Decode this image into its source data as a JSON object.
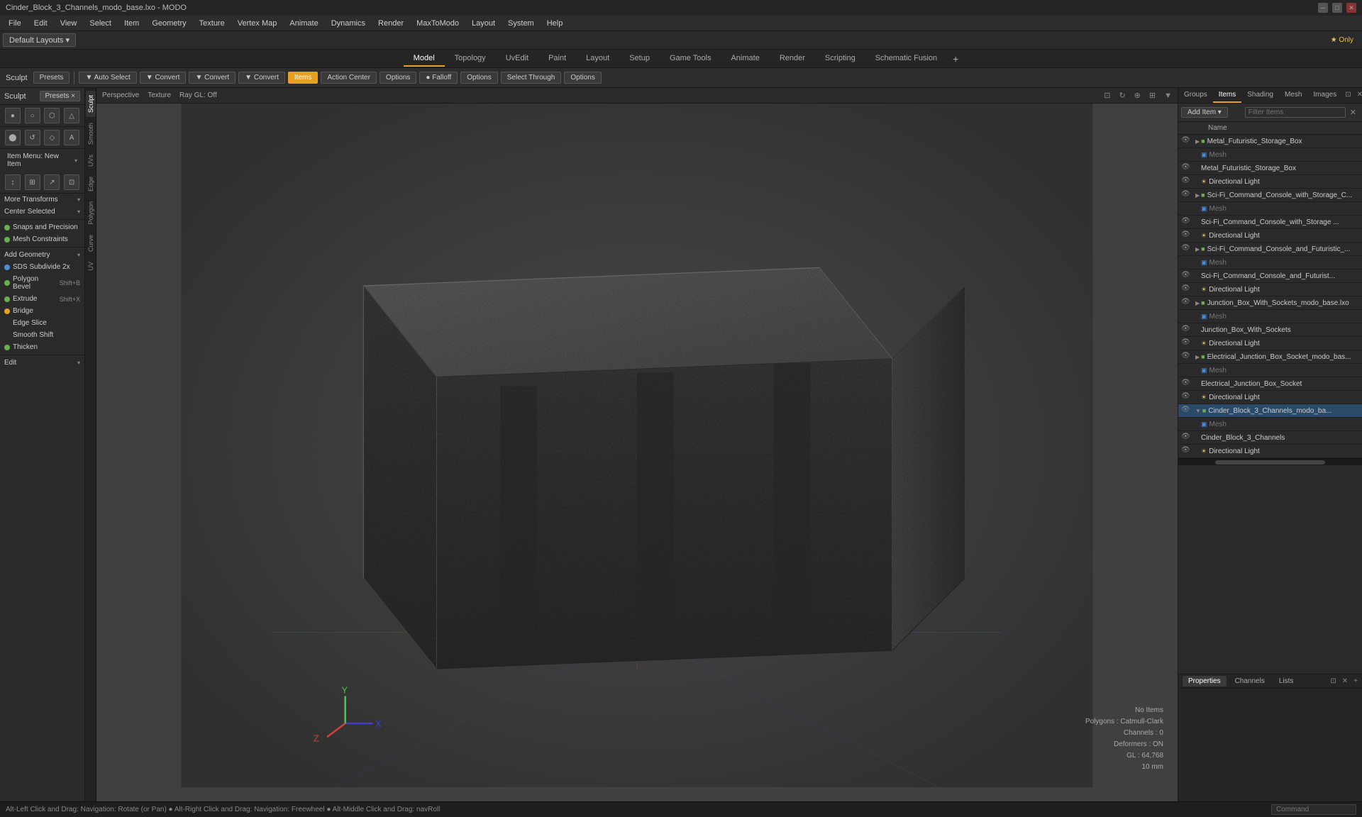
{
  "window": {
    "title": "Cinder_Block_3_Channels_modo_base.lxo - MODO"
  },
  "titlebar": {
    "title": "Cinder_Block_3_Channels_modo_base.lxo - MODO",
    "min": "─",
    "max": "□",
    "close": "✕"
  },
  "menubar": {
    "items": [
      "File",
      "Edit",
      "View",
      "Select",
      "Item",
      "Geometry",
      "Texture",
      "Vertex Map",
      "Animate",
      "Dynamics",
      "Render",
      "MaxToModo",
      "Layout",
      "System",
      "Help"
    ]
  },
  "layoutbar": {
    "layout": "Default Layouts",
    "only_label": "★ Only"
  },
  "modetabs": {
    "tabs": [
      "Model",
      "Topology",
      "UvEdit",
      "Paint",
      "Layout",
      "Setup",
      "Game Tools",
      "Animate",
      "Render",
      "Scripting",
      "Schematic Fusion"
    ],
    "active": "Model"
  },
  "toolbar": {
    "sculpt_label": "Sculpt",
    "presets_label": "Presets",
    "buttons": [
      {
        "label": "Auto Select",
        "active": false,
        "icon": "▼"
      },
      {
        "label": "Convert",
        "active": false
      },
      {
        "label": "Convert",
        "active": false
      },
      {
        "label": "Convert",
        "active": false
      },
      {
        "label": "Items",
        "active": true
      },
      {
        "label": "Action Center",
        "active": false
      },
      {
        "label": "Options",
        "active": false
      },
      {
        "label": "Falloff",
        "active": false
      },
      {
        "label": "Options",
        "active": false
      },
      {
        "label": "Select Through",
        "active": false
      },
      {
        "label": "Options",
        "active": false
      }
    ]
  },
  "leftpanel": {
    "sculpt": "Sculpt",
    "presets": "Presets",
    "tool_rows": [
      [
        "●",
        "○",
        "⬡",
        "△"
      ],
      [
        "⬤",
        "↺",
        "◇",
        "A"
      ]
    ],
    "item_menu_label": "Item Menu: New Item",
    "transform_icons": [
      "↕",
      "⊞",
      "↗",
      "⊡"
    ],
    "more_transforms": "More Transforms",
    "center_selected": "Center Selected",
    "snaps_precision": "Snaps and Precision",
    "mesh_constraints": "Mesh Constraints",
    "add_geometry": "Add Geometry",
    "tools": [
      {
        "name": "SDS Subdivide 2x",
        "shortcut": "",
        "dot": "blue"
      },
      {
        "name": "Polygon Bevel",
        "shortcut": "Shift+B",
        "dot": "green"
      },
      {
        "name": "Extrude",
        "shortcut": "Shift+X",
        "dot": "green"
      },
      {
        "name": "Bridge",
        "shortcut": "",
        "dot": "orange"
      },
      {
        "name": "Edge Slice",
        "shortcut": "",
        "dot": ""
      },
      {
        "name": "Smooth Shift",
        "shortcut": "",
        "dot": ""
      },
      {
        "name": "Thicken",
        "shortcut": "",
        "dot": "green"
      }
    ],
    "edit_label": "Edit"
  },
  "viewport": {
    "perspective": "Perspective",
    "texture": "Texture",
    "ray_gl": "Ray GL: Off",
    "status": {
      "no_items": "No Items",
      "polygons": "Polygons : Catmull-Clark",
      "channels": "Channels : 0",
      "deformers": "Deformers : ON",
      "gl": "GL : 64,768",
      "size": "10 mm"
    },
    "footer": "Alt-Left Click and Drag: Navigation: Rotate (or Pan)  ●  Alt-Right Click and Drag: Navigation: Freewheel  ●  Alt-Middle Click and Drag: navRoll"
  },
  "vert_tabs_left": [
    "Sculpt",
    "Smooth",
    "UVs",
    "Edge",
    "Polygon",
    "Curve",
    "UV"
  ],
  "rightpanel": {
    "tabs": [
      "Groups",
      "Items",
      "Shading",
      "Mesh",
      "Images"
    ],
    "active_tab": "Items",
    "add_item": "Add Item",
    "filter_items": "Filter Items",
    "col_name": "Name",
    "tree": [
      {
        "level": 1,
        "type": "group",
        "name": "Metal_Futuristic_Storage_Box",
        "expanded": true,
        "visible": true
      },
      {
        "level": 2,
        "type": "mesh",
        "name": "Mesh",
        "visible": true,
        "dim": true
      },
      {
        "level": 2,
        "type": "item",
        "name": "Metal_Futuristic_Storage_Box",
        "visible": true
      },
      {
        "level": 2,
        "type": "light",
        "name": "Directional Light",
        "visible": true
      },
      {
        "level": 1,
        "type": "group",
        "name": "Sci-Fi_Command_Console_with_Storage_C...",
        "expanded": true,
        "visible": true
      },
      {
        "level": 2,
        "type": "mesh",
        "name": "Mesh",
        "visible": true,
        "dim": true
      },
      {
        "level": 2,
        "type": "item",
        "name": "Sci-Fi_Command_Console_with_Storage ...",
        "visible": true
      },
      {
        "level": 2,
        "type": "light",
        "name": "Directional Light",
        "visible": true
      },
      {
        "level": 1,
        "type": "group",
        "name": "Sci-Fi_Command_Console_and_Futuristic_...",
        "expanded": true,
        "visible": true
      },
      {
        "level": 2,
        "type": "mesh",
        "name": "Mesh",
        "visible": true,
        "dim": true
      },
      {
        "level": 2,
        "type": "item",
        "name": "Sci-Fi_Command_Console_and_Futurist...",
        "visible": true
      },
      {
        "level": 2,
        "type": "light",
        "name": "Directional Light",
        "visible": true
      },
      {
        "level": 1,
        "type": "group",
        "name": "Junction_Box_With_Sockets_modo_base.lxo",
        "expanded": true,
        "visible": true
      },
      {
        "level": 2,
        "type": "mesh",
        "name": "Mesh",
        "visible": true,
        "dim": true
      },
      {
        "level": 2,
        "type": "item",
        "name": "Junction_Box_With_Sockets",
        "visible": true
      },
      {
        "level": 2,
        "type": "light",
        "name": "Directional Light",
        "visible": true
      },
      {
        "level": 1,
        "type": "group",
        "name": "Electrical_Junction_Box_Socket_modo_bas...",
        "expanded": true,
        "visible": true
      },
      {
        "level": 2,
        "type": "mesh",
        "name": "Mesh",
        "visible": true,
        "dim": true
      },
      {
        "level": 2,
        "type": "item",
        "name": "Electrical_Junction_Box_Socket",
        "visible": true
      },
      {
        "level": 2,
        "type": "light",
        "name": "Directional Light",
        "visible": true
      },
      {
        "level": 1,
        "type": "group",
        "name": "Cinder_Block_3_Channels_modo_ba...",
        "expanded": true,
        "visible": true,
        "selected": true
      },
      {
        "level": 2,
        "type": "mesh",
        "name": "Mesh",
        "visible": true,
        "dim": true
      },
      {
        "level": 2,
        "type": "item",
        "name": "Cinder_Block_3_Channels",
        "visible": true
      },
      {
        "level": 2,
        "type": "light",
        "name": "Directional Light",
        "visible": true
      }
    ]
  },
  "rightpanel_bottom": {
    "tabs": [
      "Properties",
      "Channels",
      "Lists"
    ],
    "active": "Properties"
  },
  "statusbar": {
    "text": "Alt-Left Click and Drag: Navigation: Rotate (or Pan)  ●  Alt-Right Click and Drag: Navigation: Freewheel  ●  Alt-Middle Click and Drag: navRoll",
    "command_placeholder": "Command"
  }
}
